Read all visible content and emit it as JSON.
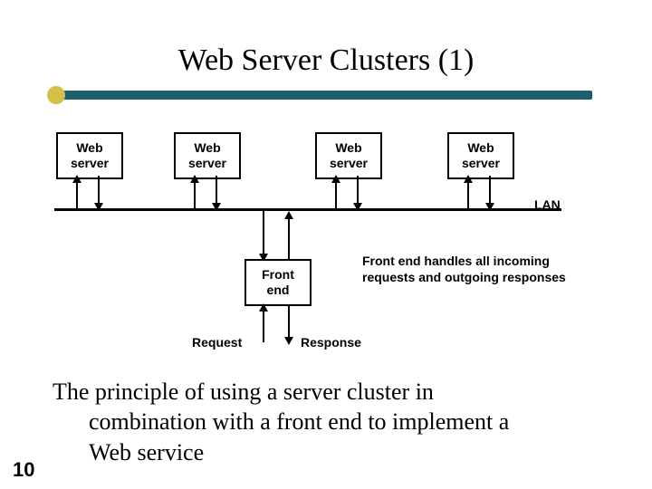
{
  "title": "Web Server Clusters (1)",
  "diagram": {
    "web_server_label": [
      "Web",
      "server"
    ],
    "front_end_label": [
      "Front",
      "end"
    ],
    "lan_label": "LAN",
    "note": "Front end handles all incoming requests and outgoing responses",
    "request_label": "Request",
    "response_label": "Response"
  },
  "caption": {
    "line1": "The principle of using a server cluster in",
    "line2": "combination with a front end to implement a",
    "line3": "Web service"
  },
  "page_number": "10"
}
